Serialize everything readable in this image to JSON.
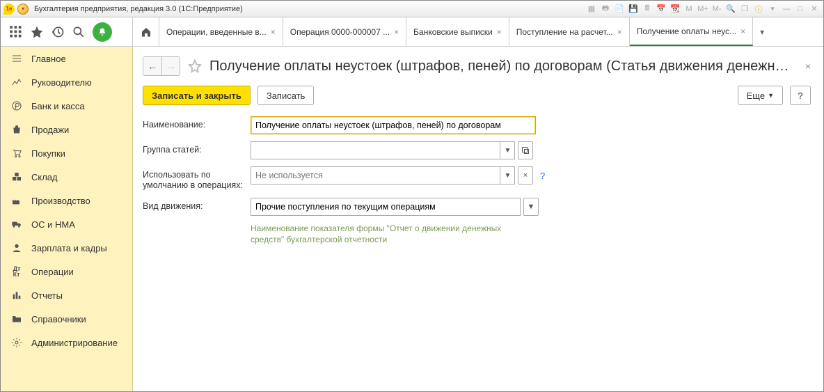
{
  "titlebar": {
    "app_title": "Бухгалтерия предприятия, редакция 3.0  (1С:Предприятие)"
  },
  "tabs": [
    {
      "label": "Операции, введенные в..."
    },
    {
      "label": "Операция 0000-000007 ..."
    },
    {
      "label": "Банковские выписки"
    },
    {
      "label": "Поступление на расчет..."
    },
    {
      "label": "Получение оплаты неус...",
      "active": true
    }
  ],
  "sidebar": {
    "items": [
      {
        "label": "Главное"
      },
      {
        "label": "Руководителю"
      },
      {
        "label": "Банк и касса"
      },
      {
        "label": "Продажи"
      },
      {
        "label": "Покупки"
      },
      {
        "label": "Склад"
      },
      {
        "label": "Производство"
      },
      {
        "label": "ОС и НМА"
      },
      {
        "label": "Зарплата и кадры"
      },
      {
        "label": "Операции"
      },
      {
        "label": "Отчеты"
      },
      {
        "label": "Справочники"
      },
      {
        "label": "Администрирование"
      }
    ]
  },
  "page": {
    "title": "Получение оплаты неустоек (штрафов, пеней) по договорам (Статья движения денежных с..."
  },
  "cmdbar": {
    "save_close_label": "Записать и закрыть",
    "save_label": "Записать",
    "more_label": "Еще",
    "help_label": "?"
  },
  "form": {
    "name_label": "Наименование:",
    "name_value": "Получение оплаты неустоек (штрафов, пеней) по договорам",
    "group_label": "Группа статей:",
    "group_value": "",
    "use_default_label": "Использовать по умолчанию в операциях:",
    "use_default_placeholder": "Не используется",
    "movement_label": "Вид движения:",
    "movement_value": "Прочие поступления по текущим операциям",
    "movement_hint": "Наименование показателя формы \"Отчет о движении денежных средств\" бухгалтерской отчетности"
  }
}
